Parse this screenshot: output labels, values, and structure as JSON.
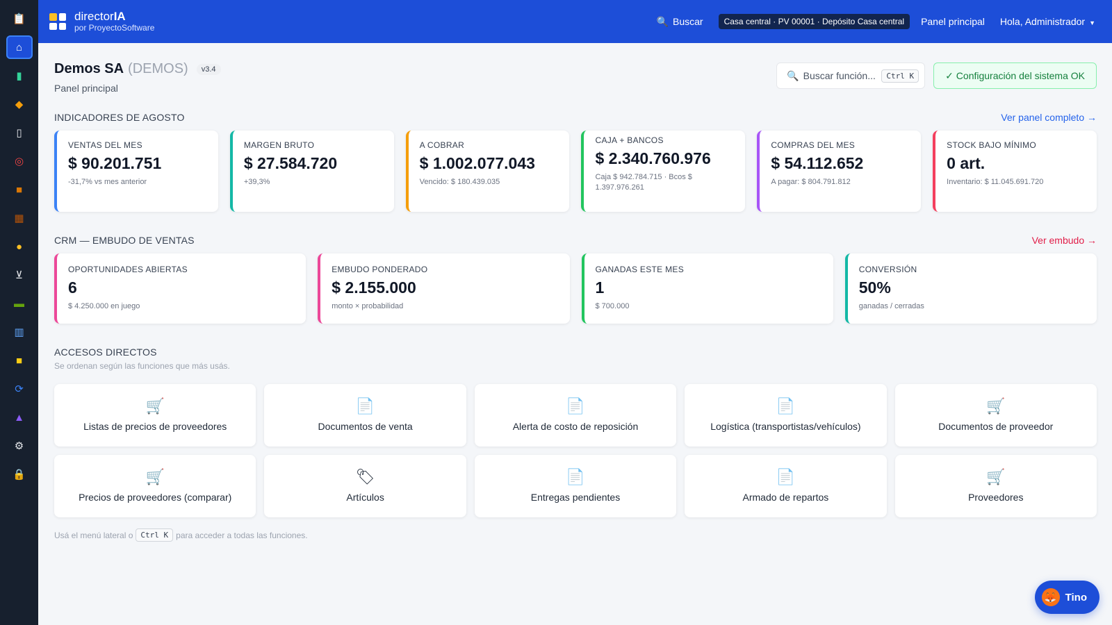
{
  "sidebar": {
    "items": [
      {
        "icon": "clipboard-icon",
        "color": "#f3f4f6"
      },
      {
        "icon": "home-icon",
        "color": "#ffffff",
        "active": true
      },
      {
        "icon": "bar-chart-icon",
        "color": "#34d399"
      },
      {
        "icon": "tag-icon",
        "color": "#f59e0b"
      },
      {
        "icon": "document-icon",
        "color": "#e5e7eb"
      },
      {
        "icon": "target-icon",
        "color": "#ef4444"
      },
      {
        "icon": "box-icon",
        "color": "#d97706"
      },
      {
        "icon": "calendar-icon",
        "color": "#b45309"
      },
      {
        "icon": "money-bag-icon",
        "color": "#fbbf24"
      },
      {
        "icon": "cart-icon",
        "color": "#e5e7eb"
      },
      {
        "icon": "cash-icon",
        "color": "#65a30d"
      },
      {
        "icon": "building-icon",
        "color": "#60a5fa"
      },
      {
        "icon": "note-icon",
        "color": "#facc15"
      },
      {
        "icon": "sync-icon",
        "color": "#3b82f6"
      },
      {
        "icon": "chart-up-icon",
        "color": "#8b5cf6"
      },
      {
        "icon": "gear-icon",
        "color": "#e5e7eb"
      },
      {
        "icon": "lock-icon",
        "color": "#facc15"
      }
    ]
  },
  "topbar": {
    "brand_name_light": "director",
    "brand_name_bold": "IA",
    "brand_sub": "por ProyectoSoftware",
    "search_label": "Buscar",
    "location": "Casa central · PV 00001 · Depósito Casa central",
    "panel_link": "Panel principal",
    "user_greeting": "Hola, Administrador"
  },
  "header": {
    "company": "Demos SA",
    "code": "(DEMOS)",
    "version": "v3.4",
    "subtitle": "Panel principal",
    "search_placeholder": "Buscar función...",
    "search_kbd": "Ctrl K",
    "config_status": "✓ Configuración del sistema OK"
  },
  "indicators": {
    "title": "INDICADORES DE AGOSTO",
    "link": "Ver panel completo →",
    "cards": [
      {
        "label": "VENTAS DEL MES",
        "value": "$ 90.201.751",
        "note": "-31,7% vs mes anterior",
        "color": "#3b82f6"
      },
      {
        "label": "MARGEN BRUTO",
        "value": "$ 27.584.720",
        "note": "+39,3%",
        "color": "#14b8a6"
      },
      {
        "label": "A COBRAR",
        "value": "$ 1.002.077.043",
        "note": "Vencido: $ 180.439.035",
        "color": "#f59e0b"
      },
      {
        "label": "CAJA + BANCOS",
        "value": "$ 2.340.760.976",
        "note": "Caja $ 942.784.715 · Bcos $ 1.397.976.261",
        "color": "#22c55e"
      },
      {
        "label": "COMPRAS DEL MES",
        "value": "$ 54.112.652",
        "note": "A pagar: $ 804.791.812",
        "color": "#a855f7"
      },
      {
        "label": "STOCK BAJO MÍNIMO",
        "value": "0 art.",
        "note": "Inventario: $ 11.045.691.720",
        "color": "#f43f5e"
      }
    ]
  },
  "crm": {
    "title": "CRM — EMBUDO DE VENTAS",
    "link": "Ver embudo →",
    "cards": [
      {
        "label": "OPORTUNIDADES ABIERTAS",
        "value": "6",
        "note": "$ 4.250.000 en juego",
        "color": "#ec4899"
      },
      {
        "label": "EMBUDO PONDERADO",
        "value": "$ 2.155.000",
        "note": "monto × probabilidad",
        "color": "#ec4899"
      },
      {
        "label": "GANADAS ESTE MES",
        "value": "1",
        "note": "$ 700.000",
        "color": "#22c55e"
      },
      {
        "label": "CONVERSIÓN",
        "value": "50%",
        "note": "ganadas / cerradas",
        "color": "#14b8a6"
      }
    ]
  },
  "shortcuts": {
    "title": "ACCESOS DIRECTOS",
    "hint": "Se ordenan según las funciones que más usás.",
    "items": [
      {
        "label": "Listas de precios de proveedores",
        "icon": "cart-icon",
        "glyph": "🛒"
      },
      {
        "label": "Documentos de venta",
        "icon": "document-icon",
        "glyph": "📄"
      },
      {
        "label": "Alerta de costo de reposición",
        "icon": "document-icon",
        "glyph": "📄"
      },
      {
        "label": "Logística (transportistas/vehículos)",
        "icon": "document-icon",
        "glyph": "📄"
      },
      {
        "label": "Documentos de proveedor",
        "icon": "cart-icon",
        "glyph": "🛒"
      },
      {
        "label": "Precios de proveedores (comparar)",
        "icon": "cart-icon",
        "glyph": "🛒"
      },
      {
        "label": "Artículos",
        "icon": "tag-icon",
        "glyph": "🏷"
      },
      {
        "label": "Entregas pendientes",
        "icon": "document-icon",
        "glyph": "📄"
      },
      {
        "label": "Armado de repartos",
        "icon": "document-icon",
        "glyph": "📄"
      },
      {
        "label": "Proveedores",
        "icon": "cart-icon",
        "glyph": "🛒"
      }
    ],
    "footer_before": "Usá el menú lateral o",
    "footer_kbd": "Ctrl K",
    "footer_after": "para acceder a todas las funciones."
  },
  "assistant": {
    "label": "Tino",
    "icon": "fox-icon"
  }
}
